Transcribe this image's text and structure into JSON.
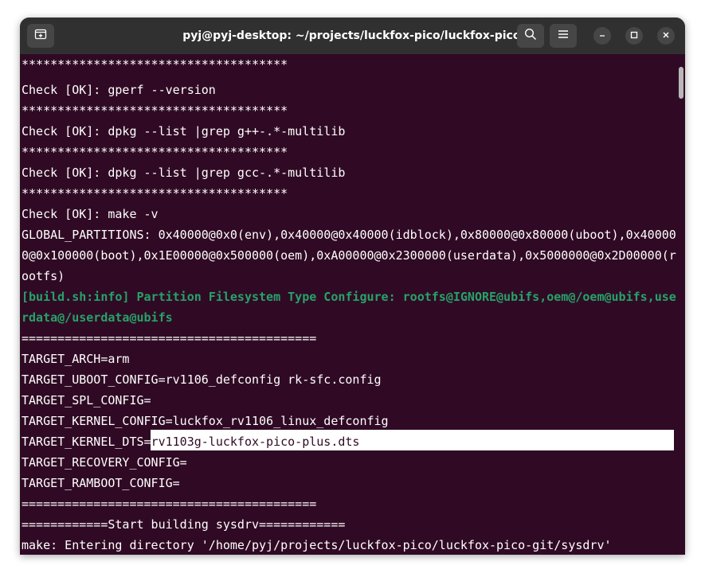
{
  "window": {
    "title": "pyj@pyj-desktop: ~/projects/luckfox-pico/luckfox-pico-git"
  },
  "icons": {
    "new_tab": "new-tab-icon",
    "search": "search-icon",
    "menu": "hamburger-menu-icon",
    "minimize": "minimize-icon",
    "maximize": "maximize-icon",
    "close": "close-icon"
  },
  "colors": {
    "terminal_bg": "#300a24",
    "titlebar_bg": "#303030",
    "info_green": "#26a269",
    "text": "#ffffff"
  },
  "terminal": {
    "lines": [
      "*************************************",
      "Check [OK]: gperf --version",
      "*************************************",
      "Check [OK]: dpkg --list |grep g++-.*-multilib",
      "*************************************",
      "Check [OK]: dpkg --list |grep gcc-.*-multilib",
      "*************************************",
      "Check [OK]: make -v",
      "GLOBAL_PARTITIONS: 0x40000@0x0(env),0x40000@0x40000(idblock),0x80000@0x80000(uboot),0x40000",
      "0@0x100000(boot),0x1E00000@0x500000(oem),0xA00000@0x2300000(userdata),0x5000000@0x2D00000(r",
      "ootfs)",
      "[build.sh:info] Partition Filesystem Type Configure: rootfs@IGNORE@ubifs,oem@/oem@ubifs,use",
      "rdata@/userdata@ubifs",
      "=========================================",
      "TARGET_ARCH=arm",
      "TARGET_UBOOT_CONFIG=rv1106_defconfig rk-sfc.config",
      "TARGET_SPL_CONFIG=",
      "TARGET_KERNEL_CONFIG=luckfox_rv1106_linux_defconfig",
      "TARGET_KERNEL_DTS=",
      "TARGET_RECOVERY_CONFIG=",
      "TARGET_RAMBOOT_CONFIG=",
      "=========================================",
      "============Start building sysdrv============",
      "make: Entering directory '/home/pyj/projects/luckfox-pico/luckfox-pico-git/sysdrv'"
    ],
    "selected_text": "rv1103g-luckfox-pico-plus.dts"
  }
}
